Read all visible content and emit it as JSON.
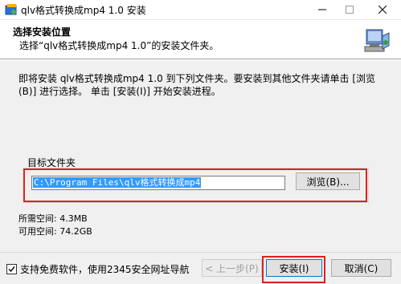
{
  "window": {
    "title": "qlv格式转换成mp4 1.0 安装"
  },
  "header": {
    "title": "选择安装位置",
    "subtitle": "选择“qlv格式转换成mp4 1.0”的安装文件夹。"
  },
  "body": {
    "instructions": "即将安装 qlv格式转换成mp4 1.0 到下列文件夹。要安装到其他文件夹请单击 [浏览(B)] 进行选择。 单击 [安装(I)] 开始安装进程。"
  },
  "destination": {
    "group_label": "目标文件夹",
    "path": "C:\\Program Files\\qlv格式转换成mp4",
    "browse_label": "浏览(B)..."
  },
  "space": {
    "required": "所需空间: 4.3MB",
    "available": "可用空间: 74.2GB"
  },
  "footer": {
    "checkbox_label": "支持免费软件，使用2345安全网址导航",
    "checkbox_checked": true,
    "back_label": "< 上一步(P)",
    "install_label": "安装(I)",
    "cancel_label": "取消(C)"
  },
  "colors": {
    "highlight": "#e21f1f",
    "selection": "#3399ff",
    "accent": "#0078d7"
  }
}
